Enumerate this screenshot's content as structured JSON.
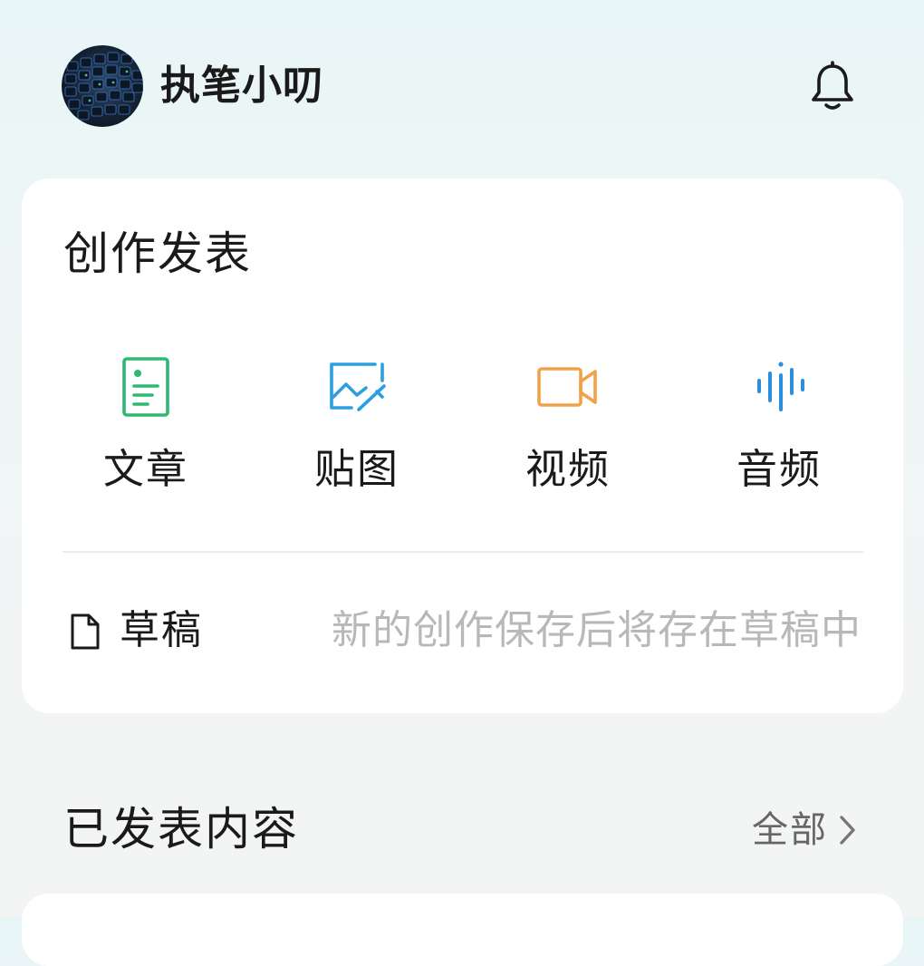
{
  "header": {
    "username": "执笔小叨",
    "avatar_icon": "avatar-keyboard-image",
    "notification_icon": "bell-icon"
  },
  "create_card": {
    "title": "创作发表",
    "actions": [
      {
        "label": "文章",
        "icon": "article-icon",
        "color": "#2eb872"
      },
      {
        "label": "贴图",
        "icon": "image-icon",
        "color": "#2b9fe0"
      },
      {
        "label": "视频",
        "icon": "video-camera-icon",
        "color": "#f0a24a"
      },
      {
        "label": "音频",
        "icon": "audio-wave-icon",
        "color": "#2b8fe0"
      }
    ],
    "drafts": {
      "label": "草稿",
      "icon": "document-icon",
      "hint": "新的创作保存后将存在草稿中"
    }
  },
  "published": {
    "title": "已发表内容",
    "see_all_label": "全部",
    "see_all_icon": "chevron-right-icon"
  }
}
